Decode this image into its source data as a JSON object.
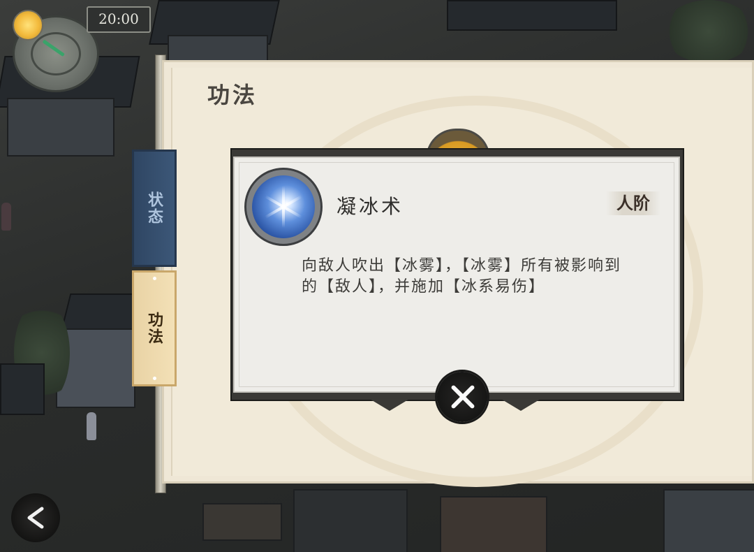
{
  "hud": {
    "time": "20:00"
  },
  "tabs": [
    {
      "label": "状态",
      "active": false
    },
    {
      "label": "功法",
      "active": true
    }
  ],
  "panel": {
    "title": "功法"
  },
  "skill": {
    "name": "凝冰术",
    "rank": "人阶",
    "description": "向敌人吹出【冰雾】，【冰雾】所有被影响到的【敌人】，并施加【冰系易伤】",
    "icon": "ice-star-icon"
  },
  "controls": {
    "close_icon": "close-icon",
    "back_icon": "back-arrow-icon"
  },
  "colors": {
    "tab_status_bg": "#34506f",
    "tab_active_bg": "#efd9ad",
    "panel_bg": "#efe7d6",
    "popup_bg": "#eeede9"
  }
}
